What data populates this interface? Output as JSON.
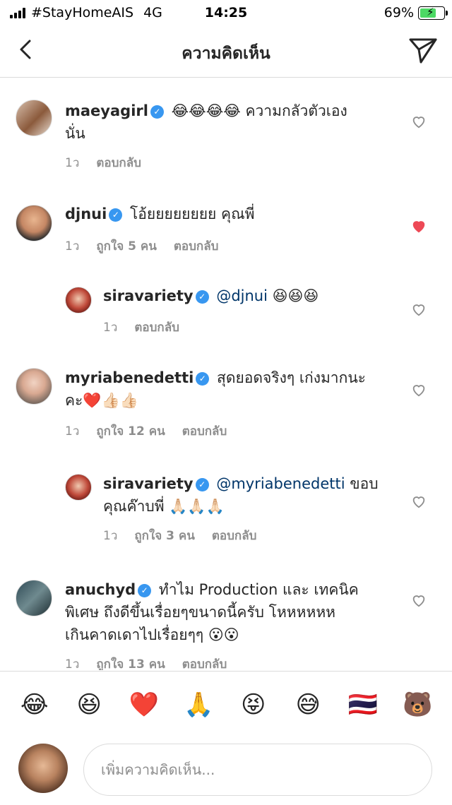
{
  "status_bar": {
    "carrier": "#StayHomeAIS",
    "network": "4G",
    "time": "14:25",
    "battery": "69%",
    "battery_level": 0.69
  },
  "nav": {
    "title": "ความคิดเห็น",
    "back_icon": "chevron-left-icon",
    "send_icon": "paper-plane-icon"
  },
  "comments": [
    {
      "user": "maeyagirl",
      "text_before": "😂😂😂😂 ความกลัวตัวเอง",
      "text_line2": "นั่น",
      "time": "1ว",
      "likes": "",
      "reply": "ตอบกลับ",
      "liked": false
    },
    {
      "user": "djnui",
      "text_before": "โอ้ยยยยยยยย คุณพี่",
      "time": "1ว",
      "likes": "ถูกใจ 5 คน",
      "reply": "ตอบกลับ",
      "liked": true
    },
    {
      "user": "siravariety",
      "mention": "@djnui",
      "text_before": "😆😆😆",
      "time": "1ว",
      "likes": "",
      "reply": "ตอบกลับ",
      "liked": false
    },
    {
      "user": "myriabenedetti",
      "text_before": "สุดยอดจริงๆ เก่งมากนะ",
      "text_line2": "คะ❤️👍🏻👍🏻",
      "time": "1ว",
      "likes": "ถูกใจ 12 คน",
      "reply": "ตอบกลับ",
      "liked": false
    },
    {
      "user": "siravariety",
      "mention": "@myriabenedetti",
      "text_before": "ขอบ",
      "text_line2": "คุณค๊าบพี่ 🙏🏻🙏🏻🙏🏻",
      "time": "1ว",
      "likes": "ถูกใจ 3 คน",
      "reply": "ตอบกลับ",
      "liked": false
    },
    {
      "user": "anuchyd",
      "text_before": "ทำไม  Production และ เทคนิค",
      "text_line2": "พิเศษ ถึงดีขึ้นเรื่อยๆขนาดนี้ครับ โหหหหหห",
      "text_line3": "เกินคาดเดาไปเรื่อยๆๆ 😮😮",
      "time": "1ว",
      "likes": "ถูกใจ 13 คน",
      "reply": "ตอบกลับ",
      "liked": false
    }
  ],
  "emoji_bar": [
    "😂",
    "😆",
    "❤️",
    "🙏",
    "😝",
    "😅",
    "🇹🇭",
    "🐻"
  ],
  "input": {
    "placeholder": "เพิ่มความคิดเห็น..."
  },
  "colors": {
    "verified": "#3897f0",
    "like_red": "#ed4956",
    "mention": "#003569",
    "meta_gray": "#8e8e8e"
  }
}
